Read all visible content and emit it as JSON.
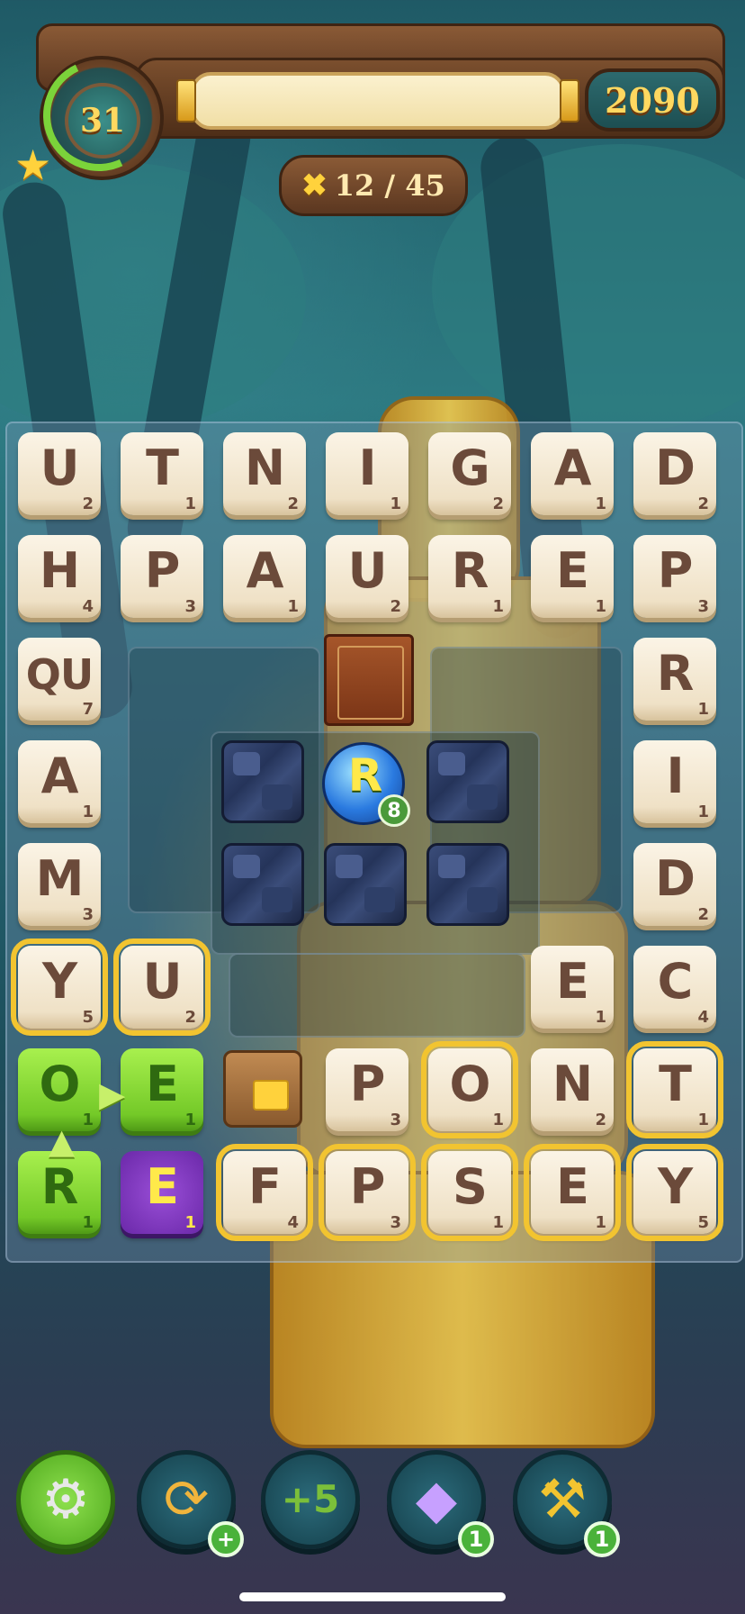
{
  "header": {
    "level": "31",
    "score": "2090",
    "moves": "12 / 45"
  },
  "board": {
    "rows": [
      [
        {
          "l": "U",
          "p": "2"
        },
        {
          "l": "T",
          "p": "1"
        },
        {
          "l": "N",
          "p": "2"
        },
        {
          "l": "I",
          "p": "1"
        },
        {
          "l": "G",
          "p": "2"
        },
        {
          "l": "A",
          "p": "1"
        },
        {
          "l": "D",
          "p": "2"
        }
      ],
      [
        {
          "l": "H",
          "p": "4"
        },
        {
          "l": "P",
          "p": "3"
        },
        {
          "l": "A",
          "p": "1"
        },
        {
          "l": "U",
          "p": "2"
        },
        {
          "l": "R",
          "p": "1"
        },
        {
          "l": "E",
          "p": "1"
        },
        {
          "l": "P",
          "p": "3"
        }
      ],
      [
        {
          "l": "QU",
          "p": "7"
        },
        null,
        null,
        null,
        null,
        null,
        {
          "l": "R",
          "p": "1"
        }
      ],
      [
        {
          "l": "A",
          "p": "1"
        },
        null,
        null,
        null,
        null,
        null,
        {
          "l": "I",
          "p": "1"
        }
      ],
      [
        {
          "l": "M",
          "p": "3"
        },
        null,
        null,
        null,
        null,
        null,
        {
          "l": "D",
          "p": "2"
        }
      ],
      [
        {
          "l": "Y",
          "p": "5"
        },
        {
          "l": "U",
          "p": "2"
        },
        null,
        null,
        null,
        {
          "l": "E",
          "p": "1"
        },
        {
          "l": "C",
          "p": "4"
        }
      ],
      [
        {
          "l": "O",
          "p": "1"
        },
        {
          "l": "E",
          "p": "1"
        },
        null,
        {
          "l": "P",
          "p": "3"
        },
        {
          "l": "O",
          "p": "1"
        },
        {
          "l": "N",
          "p": "2"
        },
        {
          "l": "T",
          "p": "1"
        }
      ],
      [
        {
          "l": "R",
          "p": "1"
        },
        {
          "l": "E",
          "p": "1"
        },
        {
          "l": "F",
          "p": "4"
        },
        {
          "l": "P",
          "p": "3"
        },
        {
          "l": "S",
          "p": "1"
        },
        {
          "l": "E",
          "p": "1"
        },
        {
          "l": "Y",
          "p": "5"
        }
      ]
    ],
    "bomb": {
      "letter": "R",
      "count": "8"
    }
  },
  "toolbar": {
    "shuffle_badge": "+",
    "swap_badge": "1",
    "hammer_badge": "1"
  },
  "colors": {
    "tile": "#efe1c6",
    "selected": "#74c928",
    "special": "#6a28a8",
    "highlight": "#f2c430"
  },
  "icons": [
    "gear-icon",
    "shuffle-icon",
    "plus-five-icon",
    "swap-icon",
    "hammer-icon",
    "star-icon",
    "crossed-swords-icon"
  ]
}
